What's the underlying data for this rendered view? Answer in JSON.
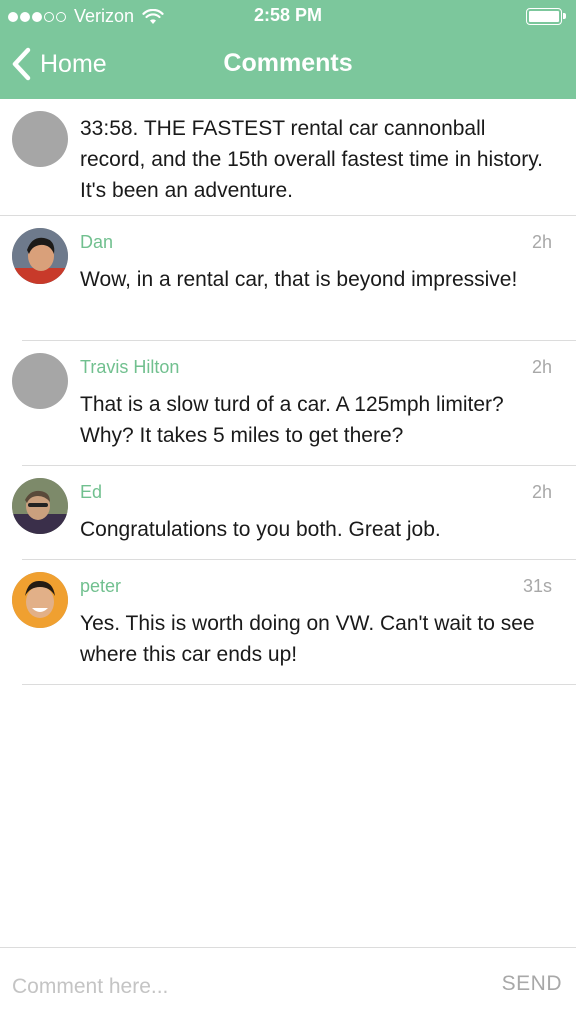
{
  "status_bar": {
    "carrier": "Verizon",
    "time": "2:58 PM",
    "signal_bars_filled": 3,
    "signal_bars_total": 5,
    "battery_level": 1.0
  },
  "nav": {
    "back_label": "Home",
    "title": "Comments"
  },
  "colors": {
    "header_bg": "#7cc79c",
    "author_name": "#71c08f",
    "timestamp": "#a8a8a8"
  },
  "post": {
    "text": "33:58. THE FASTEST rental car cannonball record, and the 15th overall fastest time in history. It's been an adventure."
  },
  "comments": [
    {
      "author": "Dan",
      "time": "2h",
      "text": "Wow, in a rental car, that is beyond impressive!"
    },
    {
      "author": "Travis Hilton",
      "time": "2h",
      "text": "That is a slow turd of a car. A 125mph limiter? Why? It takes 5 miles to get there?"
    },
    {
      "author": "Ed",
      "time": "2h",
      "text": "Congratulations to you both. Great job."
    },
    {
      "author": "peter",
      "time": "31s",
      "text": "Yes. This is worth doing on VW. Can't wait to see where this car ends up!"
    }
  ],
  "composer": {
    "placeholder": "Comment here...",
    "value": "",
    "send_label": "SEND"
  }
}
